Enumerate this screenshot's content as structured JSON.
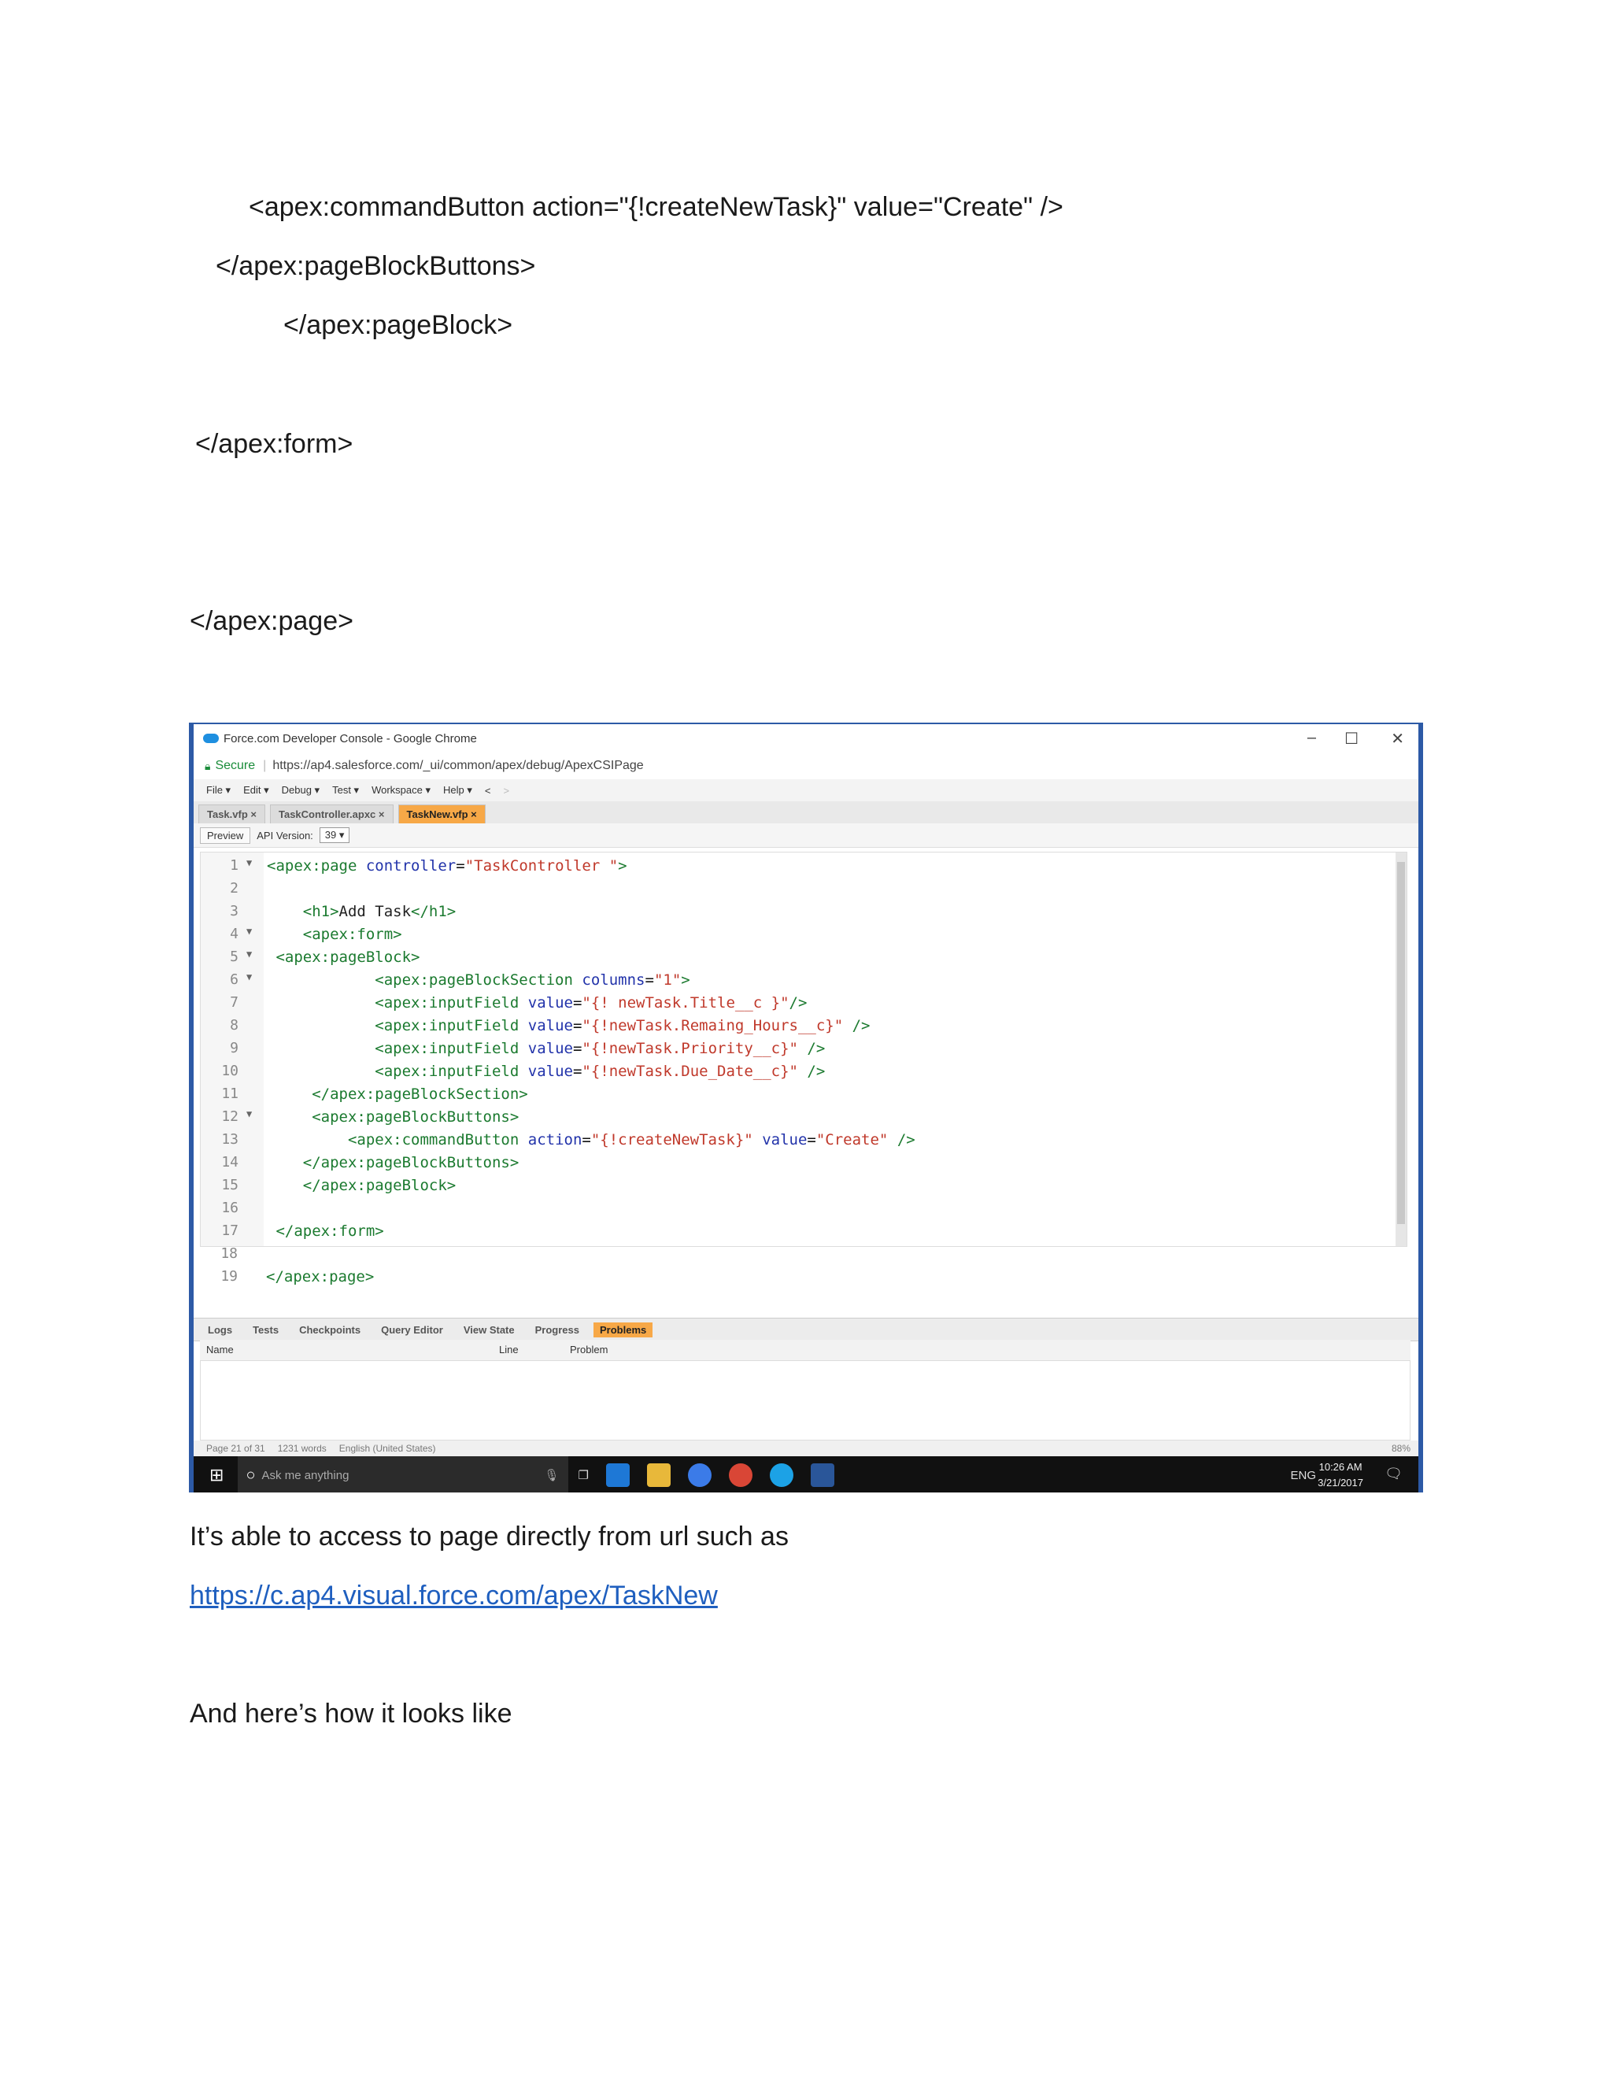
{
  "document": {
    "code_lines": [
      "<apex:commandButton action=\"{!createNewTask}\" value=\"Create\" />",
      "</apex:pageBlockButtons>",
      "</apex:pageBlock>",
      "</apex:form>",
      "</apex:page>"
    ],
    "para1": "It’s able to access to page directly from url such as",
    "url": "https://c.ap4.visual.force.com/apex/TaskNew",
    "para2": "And here’s how it looks like"
  },
  "screenshot": {
    "window_title": "Force.com Developer Console - Google Chrome",
    "secure_label": "Secure",
    "address": "https://ap4.salesforce.com/_ui/common/apex/debug/ApexCSIPage",
    "menus": [
      "File ▾",
      "Edit ▾",
      "Debug ▾",
      "Test ▾",
      "Workspace ▾",
      "Help ▾",
      "<",
      ">"
    ],
    "file_tabs": [
      {
        "label": "Task.vfp ×",
        "active": false
      },
      {
        "label": "TaskController.apxc ×",
        "active": false
      },
      {
        "label": "TaskNew.vfp ×",
        "active": true
      }
    ],
    "preview_label": "Preview",
    "api_label": "API Version:",
    "api_version": "39",
    "code_line_numbers": [
      "1",
      "2",
      "3",
      "4",
      "5",
      "6",
      "7",
      "8",
      "9",
      "10",
      "11",
      "12",
      "13",
      "14",
      "15",
      "16",
      "17",
      "18",
      "19"
    ],
    "bottom_tabs": [
      {
        "label": "Logs",
        "active": false
      },
      {
        "label": "Tests",
        "active": false
      },
      {
        "label": "Checkpoints",
        "active": false
      },
      {
        "label": "Query Editor",
        "active": false
      },
      {
        "label": "View State",
        "active": false
      },
      {
        "label": "Progress",
        "active": false
      },
      {
        "label": "Problems",
        "active": true
      }
    ],
    "problem_columns": [
      "Name",
      "Line",
      "Problem"
    ],
    "status": {
      "page": "Page 21 of 31",
      "words": "1231 words",
      "language": "English (United States)",
      "zoom": "88%"
    },
    "taskbar": {
      "search_placeholder": "Ask me anything",
      "lang": "ENG",
      "time": "10:26 AM",
      "date": "3/21/2017"
    }
  }
}
